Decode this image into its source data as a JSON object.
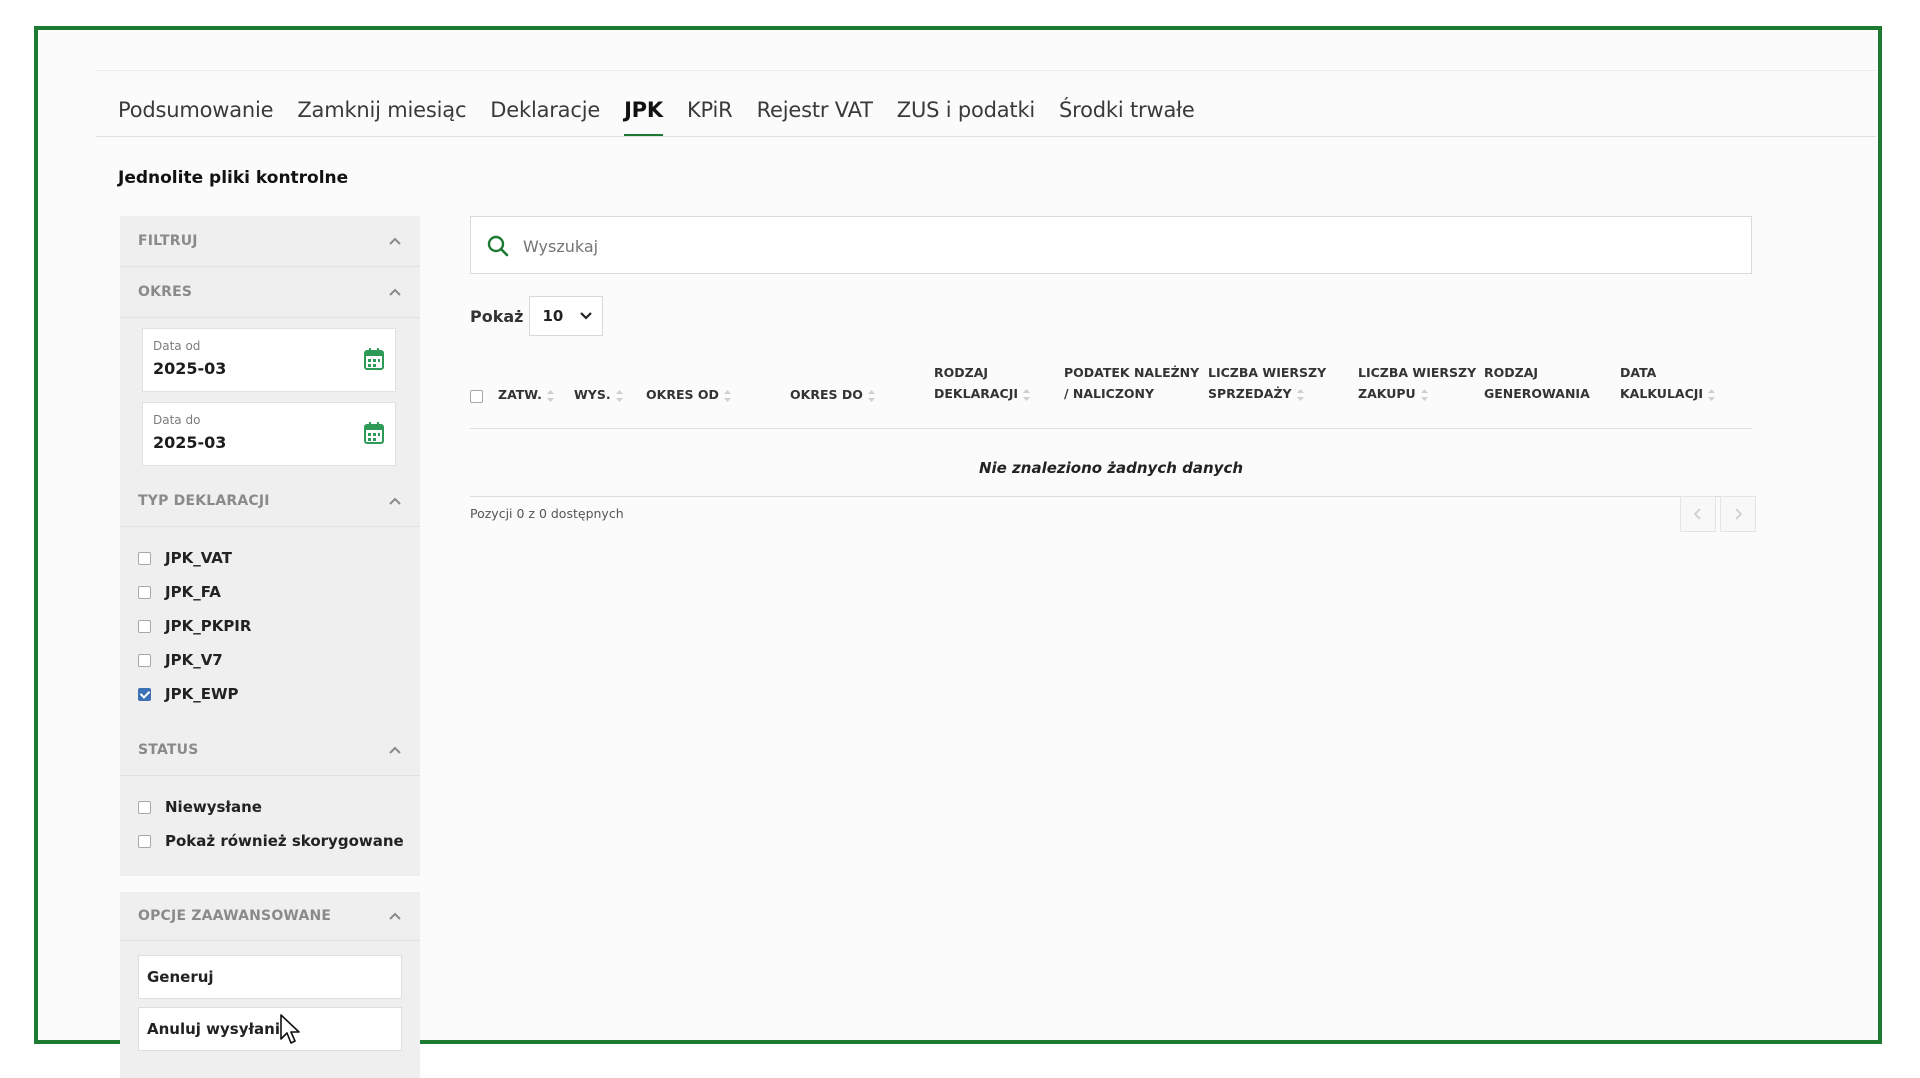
{
  "tabs": [
    {
      "label": "Podsumowanie"
    },
    {
      "label": "Zamknij miesiąc"
    },
    {
      "label": "Deklaracje"
    },
    {
      "label": "JPK",
      "active": true
    },
    {
      "label": "KPiR"
    },
    {
      "label": "Rejestr VAT"
    },
    {
      "label": "ZUS i podatki"
    },
    {
      "label": "Środki trwałe"
    }
  ],
  "page": {
    "title": "Jednolite pliki kontrolne"
  },
  "filters": {
    "header": "FILTRUJ",
    "period": {
      "header": "OKRES",
      "date_from_label": "Data od",
      "date_from_value": "2025-03",
      "date_to_label": "Data do",
      "date_to_value": "2025-03"
    },
    "declaration_type": {
      "header": "TYP DEKLARACJI",
      "options": [
        {
          "label": "JPK_VAT",
          "checked": false
        },
        {
          "label": "JPK_FA",
          "checked": false
        },
        {
          "label": "JPK_PKPIR",
          "checked": false
        },
        {
          "label": "JPK_V7",
          "checked": false
        },
        {
          "label": "JPK_EWP",
          "checked": true
        }
      ]
    },
    "status": {
      "header": "STATUS",
      "options": [
        {
          "label": "Niewysłane",
          "checked": false
        },
        {
          "label": "Pokaż również skorygowane",
          "checked": false
        }
      ]
    }
  },
  "advanced": {
    "header": "OPCJE ZAAWANSOWANE",
    "generate_label": "Generuj",
    "cancel_send_label": "Anuluj wysyłanie"
  },
  "search": {
    "placeholder": "Wyszukaj"
  },
  "page_size": {
    "label": "Pokaż",
    "value": "10"
  },
  "table": {
    "columns": [
      {
        "line1": "ZATW.",
        "line2": ""
      },
      {
        "line1": "WYS.",
        "line2": ""
      },
      {
        "line1": "OKRES OD",
        "line2": ""
      },
      {
        "line1": "OKRES DO",
        "line2": ""
      },
      {
        "line1": "RODZAJ",
        "line2": "DEKLARACJI"
      },
      {
        "line1": "PODATEK NALEŻNY",
        "line2": "/ NALICZONY"
      },
      {
        "line1": "LICZBA WIERSZY",
        "line2": "SPRZEDAŻY"
      },
      {
        "line1": "LICZBA WIERSZY",
        "line2": "ZAKUPU"
      },
      {
        "line1": "RODZAJ",
        "line2": "GENEROWANIA"
      },
      {
        "line1": "DATA",
        "line2": "KALKULACJI"
      }
    ],
    "empty_message": "Nie znaleziono żadnych danych",
    "info": "Pozycji 0 z 0 dostępnych"
  },
  "colors": {
    "accent": "#1d7a33",
    "checkbox_checked": "#3b70b4",
    "calendar_icon": "#2e9a57"
  }
}
